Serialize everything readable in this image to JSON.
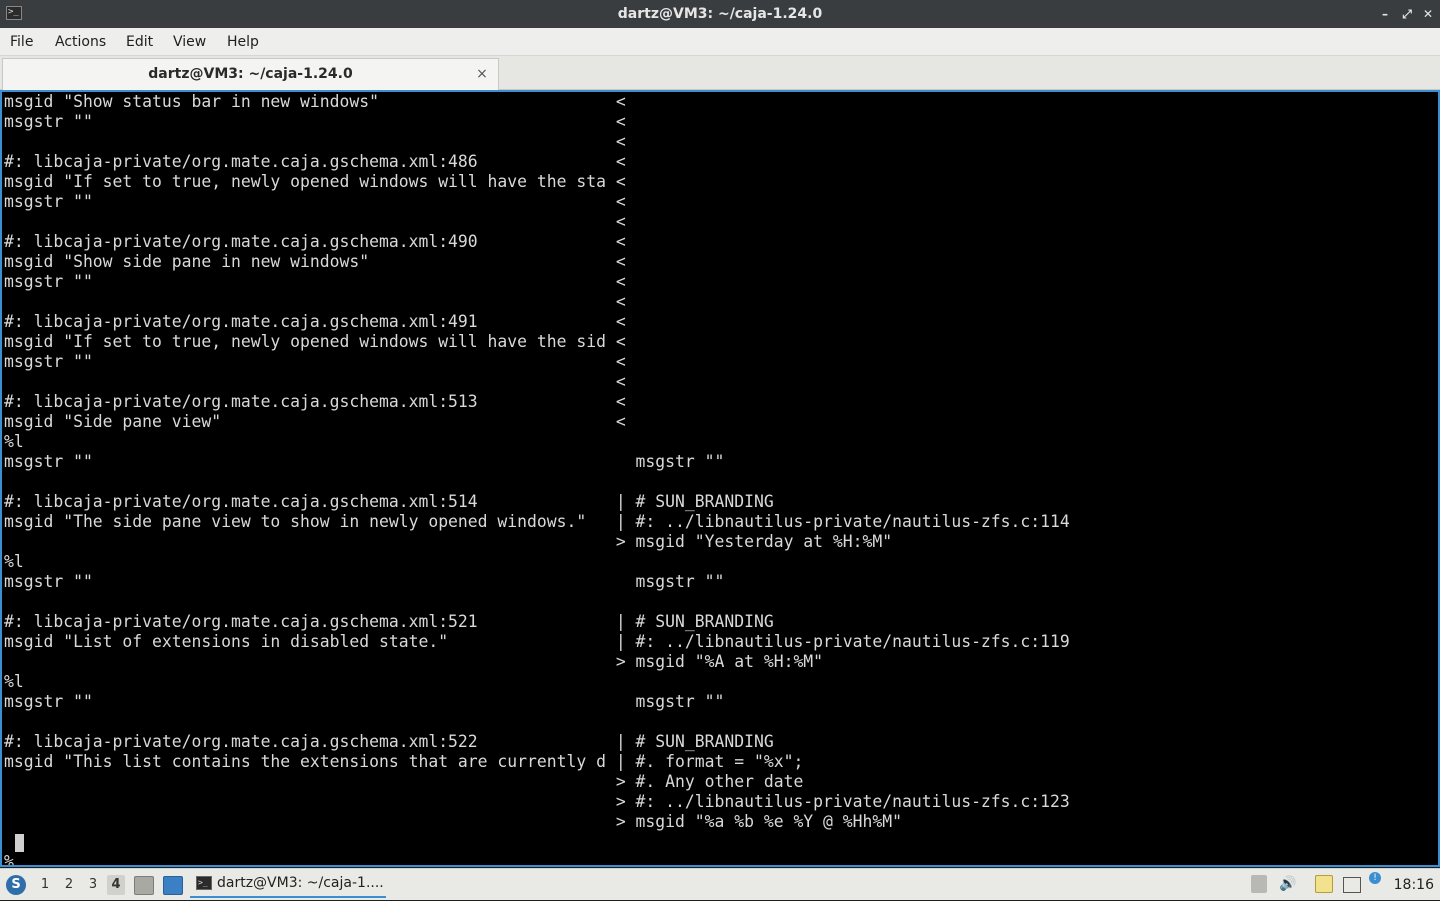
{
  "window": {
    "title": "dartz@VM3: ~/caja-1.24.0",
    "controls": {
      "minimize": "–",
      "maximize": "⤢",
      "close": "✕"
    }
  },
  "menubar": {
    "items": [
      "File",
      "Actions",
      "Edit",
      "View",
      "Help"
    ]
  },
  "tab": {
    "label": "dartz@VM3: ~/caja-1.24.0",
    "close": "×"
  },
  "terminal": {
    "lines": [
      "msgid \"Show status bar in new windows\"                        <",
      "msgstr \"\"                                                     <",
      "                                                              <",
      "#: libcaja-private/org.mate.caja.gschema.xml:486              <",
      "msgid \"If set to true, newly opened windows will have the sta <",
      "msgstr \"\"                                                     <",
      "                                                              <",
      "#: libcaja-private/org.mate.caja.gschema.xml:490              <",
      "msgid \"Show side pane in new windows\"                         <",
      "msgstr \"\"                                                     <",
      "                                                              <",
      "#: libcaja-private/org.mate.caja.gschema.xml:491              <",
      "msgid \"If set to true, newly opened windows will have the sid <",
      "msgstr \"\"                                                     <",
      "                                                              <",
      "#: libcaja-private/org.mate.caja.gschema.xml:513              <",
      "msgid \"Side pane view\"                                        <",
      "%l",
      "msgstr \"\"                                                       msgstr \"\"",
      "",
      "#: libcaja-private/org.mate.caja.gschema.xml:514              | # SUN_BRANDING",
      "msgid \"The side pane view to show in newly opened windows.\"   | #: ../libnautilus-private/nautilus-zfs.c:114",
      "                                                              > msgid \"Yesterday at %H:%M\"",
      "%l",
      "msgstr \"\"                                                       msgstr \"\"",
      "",
      "#: libcaja-private/org.mate.caja.gschema.xml:521              | # SUN_BRANDING",
      "msgid \"List of extensions in disabled state.\"                 | #: ../libnautilus-private/nautilus-zfs.c:119",
      "                                                              > msgid \"%A at %H:%M\"",
      "%l",
      "msgstr \"\"                                                       msgstr \"\"",
      "",
      "#: libcaja-private/org.mate.caja.gschema.xml:522              | # SUN_BRANDING",
      "msgid \"This list contains the extensions that are currently d | #. format = \"%x\";",
      "                                                              > #. Any other date",
      "                                                              > #: ../libnautilus-private/nautilus-zfs.c:123",
      "                                                              > msgid \"%a %b %e %Y @ %Hh%M\"",
      "",
      "%"
    ]
  },
  "taskbar": {
    "workspaces": [
      "1",
      "2",
      "3",
      "4"
    ],
    "active_workspace": "4",
    "task_label": "dartz@VM3: ~/caja-1....",
    "clock": "18:16",
    "colors": {
      "accent": "#3b8ed0"
    }
  }
}
